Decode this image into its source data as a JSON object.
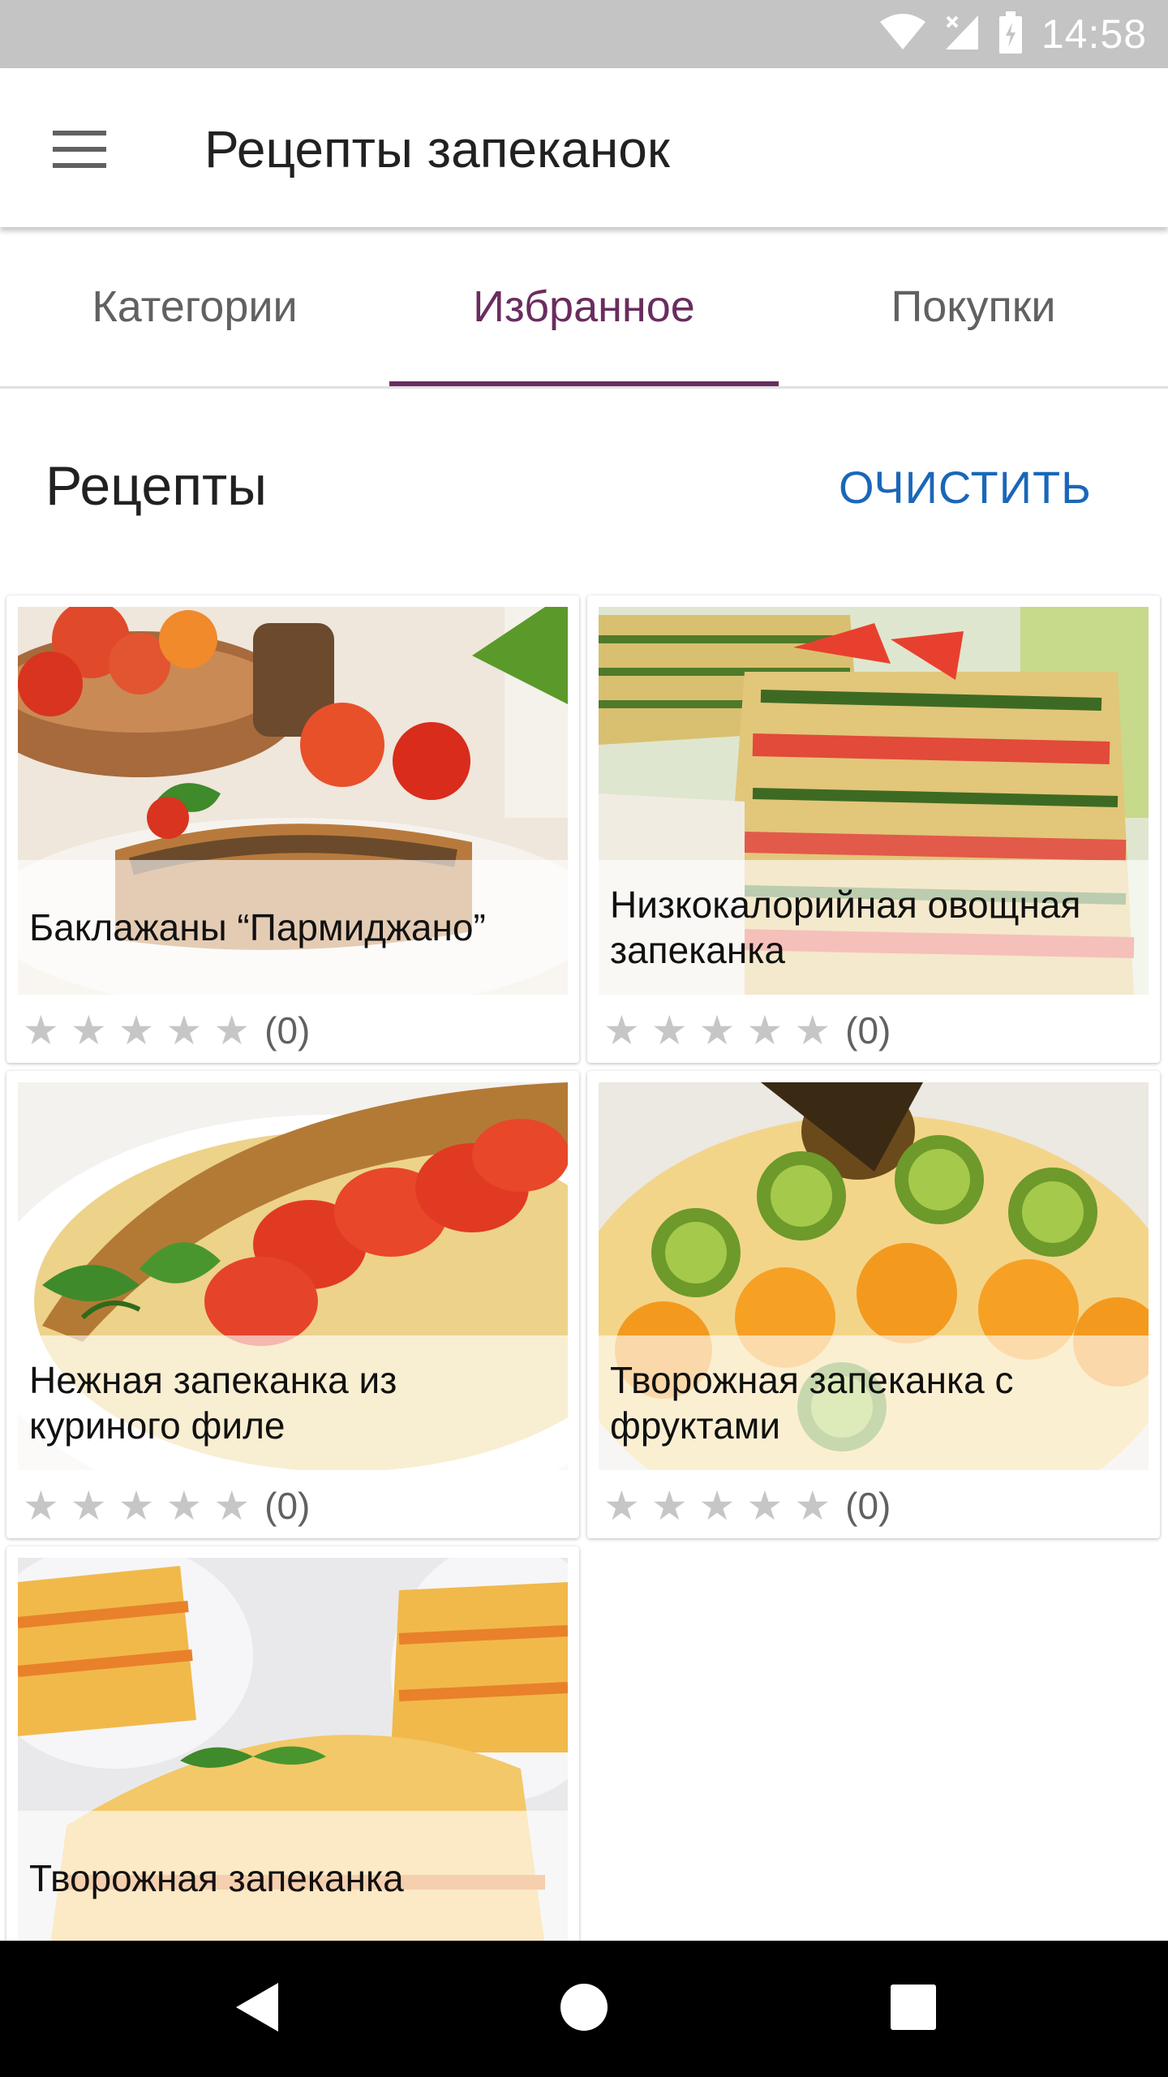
{
  "status_bar": {
    "time": "14:58"
  },
  "app_bar": {
    "title": "Рецепты запеканок"
  },
  "tabs": [
    {
      "label": "Категории",
      "active": false
    },
    {
      "label": "Избранное",
      "active": true
    },
    {
      "label": "Покупки",
      "active": false
    }
  ],
  "section": {
    "title": "Рецепты",
    "clear_label": "ОЧИСТИТЬ"
  },
  "recipes": [
    {
      "title": "Баклажаны “Пармиджано”",
      "rating_count": "(0)",
      "stars": 0
    },
    {
      "title": "Низкокалорийная овощная запеканка",
      "rating_count": "(0)",
      "stars": 0
    },
    {
      "title": "Нежная запеканка из куриного филе",
      "rating_count": "(0)",
      "stars": 0
    },
    {
      "title": "Творожная запеканка с фруктами",
      "rating_count": "(0)",
      "stars": 0
    },
    {
      "title": "Творожная запеканка",
      "rating_count": "",
      "stars": 0
    }
  ],
  "colors": {
    "accent": "#6a2c5f",
    "link": "#1a67b8",
    "status_bar": "#c4c4c4"
  },
  "icons": [
    "menu-icon",
    "wifi-icon",
    "signal-icon",
    "battery-icon",
    "back-icon",
    "home-icon",
    "recents-icon",
    "star-icon"
  ]
}
